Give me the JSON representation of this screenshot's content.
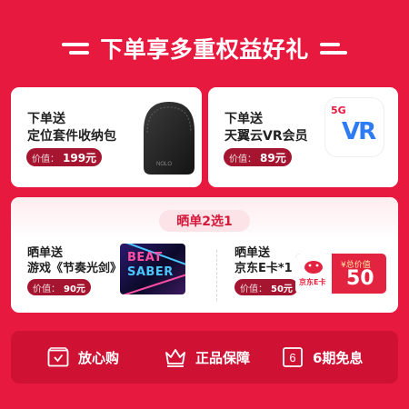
{
  "header": {
    "title": "下单享多重权益好礼"
  },
  "gift_headphone_case": {
    "line1": "下单送",
    "line2": "定位套件收纳包",
    "price_label": "价值：",
    "price_value": "199元",
    "product_logo": "NOLO"
  },
  "gift_vip": {
    "line1": "下单送",
    "line2": "天翼云VR会员",
    "price_label": "价值：",
    "price_value": "89元",
    "app_badge": "5G",
    "app_letters": "VR"
  },
  "choose_section": {
    "title": "晒单2选1",
    "option_game": {
      "line1": "晒单送",
      "line2": "游戏《节奏光剑》",
      "price_label": "价值：",
      "price_value": "90元",
      "image_text_1": "BEAT",
      "image_text_2": "SABER"
    },
    "option_ecard": {
      "line1": "晒单送",
      "line2": "京东E卡*1",
      "price_label": "价值：",
      "price_value": "50元",
      "card_brand": "京东E卡",
      "card_currency": "¥总价值",
      "card_value": "50"
    }
  },
  "features": [
    {
      "label": "放心购",
      "icon": "checkmark-box-icon"
    },
    {
      "label": "正品保障",
      "icon": "crown-icon"
    },
    {
      "label": "6期免息",
      "icon": "six-box-icon",
      "icon_text": "6"
    }
  ],
  "colors": {
    "background": "#e8193f",
    "card": "#ffffff",
    "price_pill": "#a5152f",
    "accent": "#d41a3c",
    "feature_bar": "#cf1234"
  }
}
